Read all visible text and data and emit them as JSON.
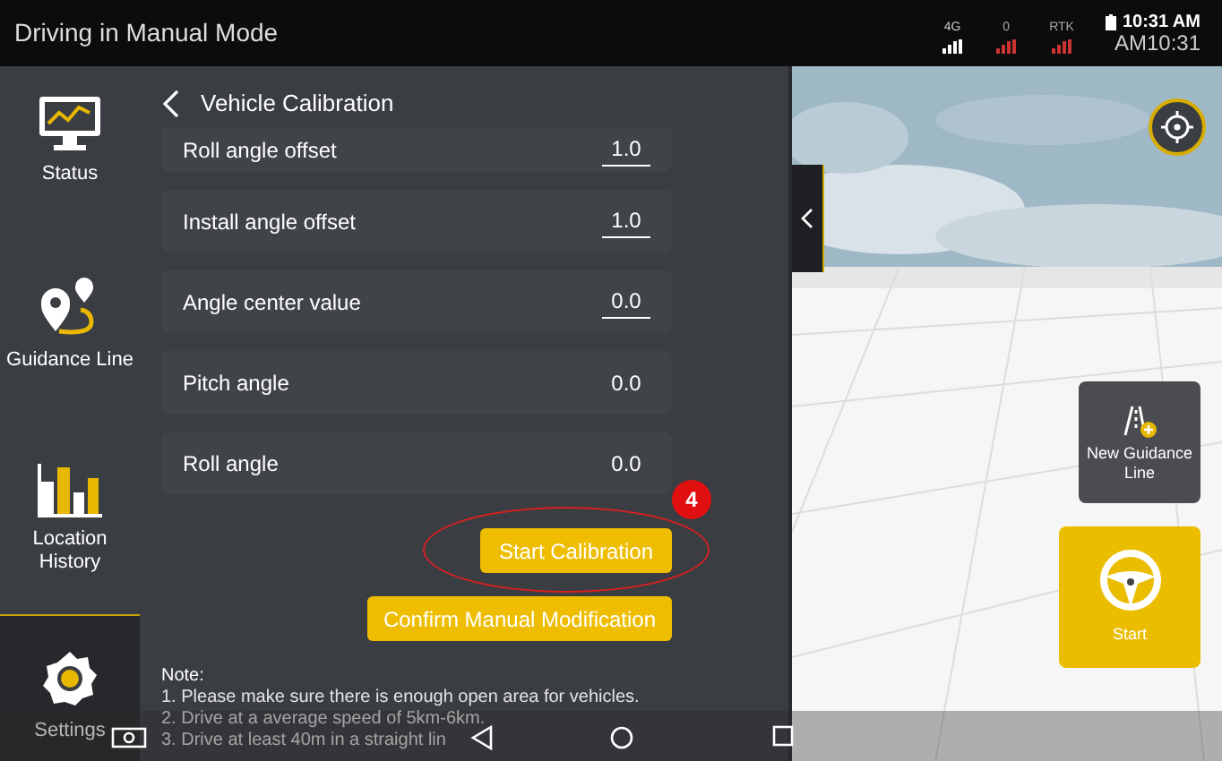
{
  "status_bar": {
    "title": "Driving in Manual Mode",
    "network": "4G",
    "satellites": "0",
    "rtk": "RTK",
    "time": "10:31 AM",
    "time_alt": "AM10:31"
  },
  "sidebar": {
    "items": [
      {
        "label": "Status",
        "kind": "monitor",
        "selected": false
      },
      {
        "label": "Guidance Line",
        "kind": "route",
        "selected": false
      },
      {
        "label": "Location History",
        "kind": "bars",
        "selected": false
      },
      {
        "label": "Settings",
        "kind": "gear",
        "selected": true
      }
    ]
  },
  "panel": {
    "title": "Vehicle Calibration",
    "rows": [
      {
        "label": "Roll angle offset",
        "value": "1.0",
        "kind": "input"
      },
      {
        "label": "Install angle offset",
        "value": "1.0",
        "kind": "input"
      },
      {
        "label": "Angle center value",
        "value": "0.0",
        "kind": "input"
      },
      {
        "label": "Pitch angle",
        "value": "0.0",
        "kind": "readout"
      },
      {
        "label": "Roll angle",
        "value": "0.0",
        "kind": "readout"
      }
    ],
    "buttons": [
      "Start Calibration",
      "Confirm Manual Modification"
    ],
    "annotation": "4",
    "note_title": "Note:",
    "notes": [
      "1. Please make sure there is enough open area for vehicles.",
      "2. Drive at a average speed of 5km-6km.",
      "3. Drive at least 40m in a straight lin"
    ]
  },
  "map": {
    "new_line_button": "New Guidance Line",
    "start_button": "Start"
  }
}
